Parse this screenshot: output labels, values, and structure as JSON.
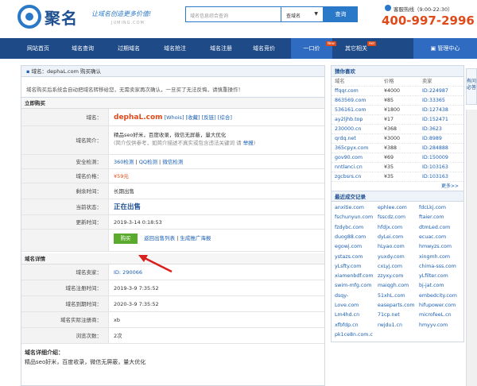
{
  "header": {
    "logo_text": "聚名",
    "slogan": "让域名创造更多价值!",
    "domain_url": "JUMING.COM",
    "search_placeholder": "域名信息综合查询",
    "search_select": "查域名",
    "search_button": "查询",
    "hotline_label": "客服热线（9:00-22:30）",
    "hotline_number": "400-997-2996"
  },
  "nav": {
    "items": [
      "网站首页",
      "域名查询",
      "过期域名",
      "域名抢注",
      "域名注册",
      "域名竞价",
      "一口价",
      "其它相关"
    ],
    "badges": [
      "New",
      "Hot"
    ],
    "manage": "管理中心"
  },
  "main": {
    "breadcrumb": "域名：dephaL.com 购买确认",
    "note": "域名购买后系统会自动把域名转移给您，无需卖家再次确认，一旦买了无法反悔，请慎重操作！",
    "buy_section": "立即购买",
    "rows": {
      "domain_label": "域名：",
      "domain_value": "dephaL.com",
      "domain_links": [
        "[Whois]",
        "[收藏]",
        "[反链]",
        "[综合]"
      ],
      "intro_label": "域名简介：",
      "intro_line1": "精品seo好米，百度收录，微信无屏蔽，量大优化",
      "intro_line2": "(简介仅供参考，如简介描述不真实或包含违法关键词 请",
      "intro_report": "举报",
      "intro_close": ")",
      "security_label": "安全检测：",
      "security_links": [
        "360检测",
        "QQ检测",
        "微信检测"
      ],
      "price_label": "域名价格：",
      "price_value": "¥59元",
      "term_label": "剩余时间：",
      "term_value": "长期出售",
      "status_label": "当前状态：",
      "status_value": "正在出售",
      "update_label": "更新时间：",
      "update_value": "2019-3-14 0:18:53",
      "buy_button": "购买",
      "back_link": "返回出售列表",
      "promo_link": "生成推广海报"
    },
    "detail_section": "域名详情",
    "details": [
      {
        "label": "域名卖家：",
        "value": "ID: 290066"
      },
      {
        "label": "域名注册时间：",
        "value": "2019-3-9 7:35:52"
      },
      {
        "label": "域名到期时间：",
        "value": "2020-3-9 7:35:52"
      },
      {
        "label": "域名实际注册商：",
        "value": "xb"
      },
      {
        "label": "浏览次数：",
        "value": "2次"
      }
    ],
    "intro_section": "域名详细介绍：",
    "intro_text": "精品seo好米，百度收录，微信无屏蔽，量大优化"
  },
  "side": {
    "guess_title": "猜你喜欢",
    "columns": [
      "域名",
      "价格",
      "卖家"
    ],
    "rows": [
      [
        "ffqqr.com",
        "¥4000",
        "ID:224987"
      ],
      [
        "863569.com",
        "¥85",
        "ID:33365"
      ],
      [
        "536161.com",
        "¥1800",
        "ID:127438"
      ],
      [
        "ay2ljhb.top",
        "¥17",
        "ID:152471"
      ],
      [
        "230000.cn",
        "¥368",
        "ID:3623"
      ],
      [
        "qrdq.net",
        "¥3000",
        "ID:8989"
      ],
      [
        "365cpyx.com",
        "¥388",
        "ID:284888"
      ],
      [
        "gov90.com",
        "¥69",
        "ID:150009"
      ],
      [
        "nntlanci.cn",
        "¥35",
        "ID:103163"
      ],
      [
        "zgcbsrs.cn",
        "¥35",
        "ID:103163"
      ]
    ],
    "more": "更多>>",
    "deal_title": "最近成交记录",
    "deals": [
      [
        "anxitie.com",
        "ephlee.com",
        "fdcLkj.com"
      ],
      [
        "fschunyun.com",
        "fsscdz.com",
        "ftaier.com"
      ],
      [
        "fzdybc.com",
        "hfdjx.com",
        "dtmLed.com"
      ],
      [
        "duog88.com",
        "dyLei.com",
        "ecuac.com"
      ],
      [
        "egowj.com",
        "hLyao.com",
        "hmwyzs.com"
      ],
      [
        "ystazs.com",
        "yuxdy.com",
        "xingmh.com"
      ],
      [
        "yLsfty.com",
        "cxLyj.com",
        "chima-sss.com"
      ],
      [
        "xiamenbdf.com",
        "zzyxy.com",
        "yLfilter.com"
      ],
      [
        "swim-mfg.com",
        "maiqgh.com",
        "bj-jat.com"
      ],
      [
        "dsqy-",
        "51xhL.com",
        "embedcity.com"
      ],
      [
        "Love.com",
        "easeparts.com",
        "hifupower.com"
      ],
      [
        "Lm4hd.cn",
        "71cp.net",
        "microfeeL.cn"
      ],
      [
        "xfbfdp.cn",
        "rwjdu1.cn",
        "hmyyv.com"
      ],
      [
        "pk1ce8n.com.c",
        "",
        ""
      ]
    ]
  },
  "float_widget": "有问必答"
}
